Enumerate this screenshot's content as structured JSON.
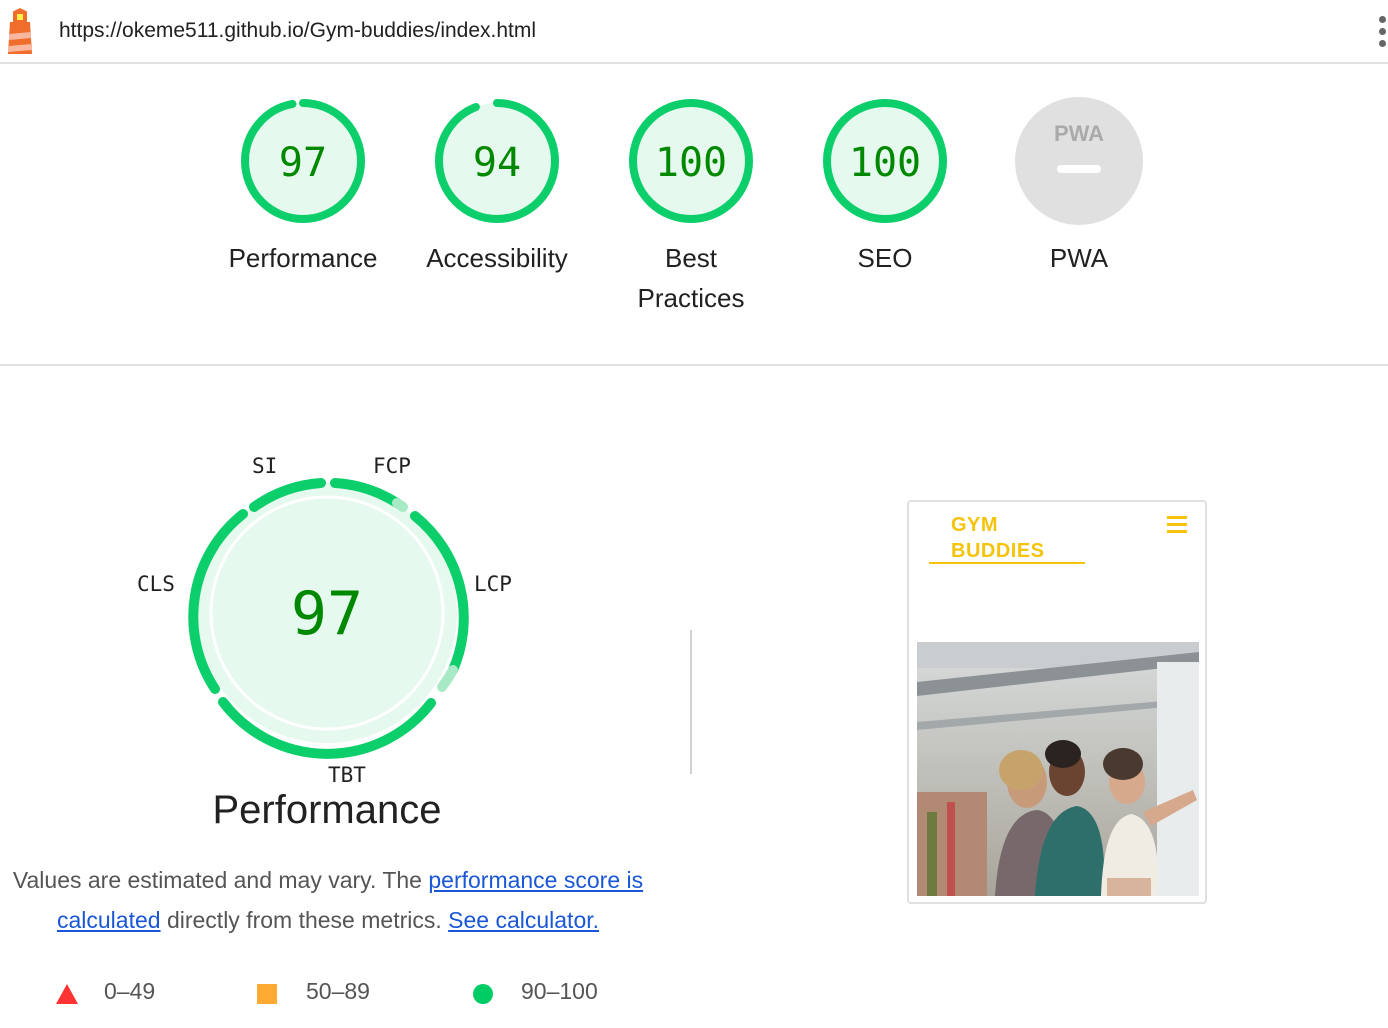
{
  "header": {
    "url": "https://okeme511.github.io/Gym-buddies/index.html",
    "logo_icon": "lighthouse-icon",
    "menu_icon": "more-vert-icon"
  },
  "categories": [
    {
      "score": "97",
      "label": "Performance",
      "value": 0.97
    },
    {
      "score": "94",
      "label": "Accessibility",
      "value": 0.94
    },
    {
      "score": "100",
      "label": "Best Practices",
      "value": 1.0
    },
    {
      "score": "100",
      "label": "SEO",
      "value": 1.0
    },
    {
      "score": "",
      "label": "PWA",
      "badge": "PWA",
      "value": null
    }
  ],
  "performance": {
    "score": "97",
    "title": "Performance",
    "metrics": [
      "SI",
      "FCP",
      "LCP",
      "TBT",
      "CLS"
    ]
  },
  "description": {
    "text_before": "Values are estimated and may vary. The ",
    "link1": "performance score is calculated",
    "text_middle": " directly from these metrics. ",
    "link2": "See calculator."
  },
  "legend": [
    {
      "range": "0–49",
      "shape": "triangle",
      "color": "#f33"
    },
    {
      "range": "50–89",
      "shape": "square",
      "color": "#fa3"
    },
    {
      "range": "90–100",
      "shape": "circle",
      "color": "#0c6"
    }
  ],
  "screenshot": {
    "logo_line1": "GYM",
    "logo_line2": "BUDDIES",
    "menu_icon": "hamburger-icon"
  },
  "colors": {
    "pass": "#0cce6b",
    "pass_text": "#008800",
    "pass_fill": "#e6f9ee",
    "average": "#ffa400",
    "fail": "#ff4e42",
    "na": "#e0e0e0",
    "link": "#1a57d6",
    "brand_yellow": "#f5c40a"
  }
}
